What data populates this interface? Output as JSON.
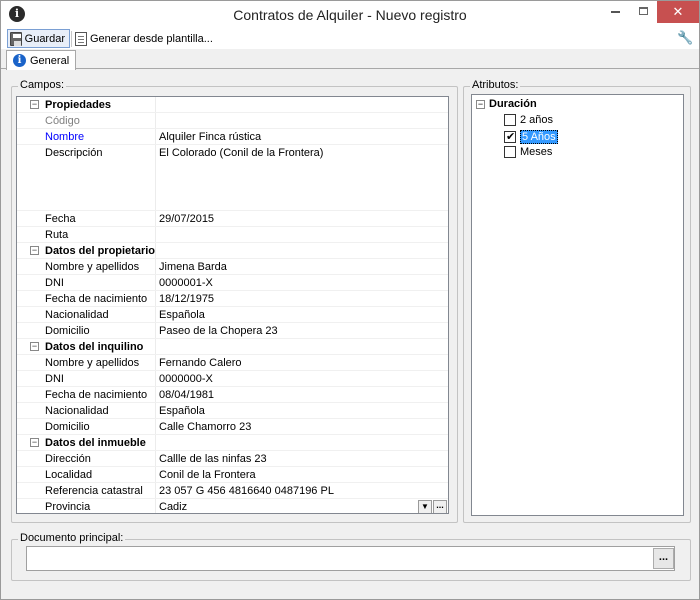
{
  "window": {
    "title": "Contratos de Alquiler - Nuevo registro",
    "close_glyph": "✕"
  },
  "toolbar": {
    "save_label": "Guardar",
    "generate_label": "Generar desde plantilla..."
  },
  "tabs": [
    {
      "label": "General",
      "icon": "info-icon",
      "active": true
    }
  ],
  "campos": {
    "legend": "Campos:",
    "rows": [
      {
        "type": "category",
        "label": "Propiedades"
      },
      {
        "type": "field",
        "label": "Código",
        "value": "",
        "style": "muted"
      },
      {
        "type": "field",
        "label": "Nombre",
        "value": "Alquiler Finca  rústica",
        "style": "required"
      },
      {
        "type": "field",
        "label": "Descripción",
        "value": "El Colorado (Conil de la Frontera)",
        "multiline": true
      },
      {
        "type": "field",
        "label": "Fecha",
        "value": "29/07/2015"
      },
      {
        "type": "field",
        "label": "Ruta",
        "value": ""
      },
      {
        "type": "category",
        "label": "Datos del propietario"
      },
      {
        "type": "field",
        "label": "Nombre y apellidos",
        "value": "Jimena Barda"
      },
      {
        "type": "field",
        "label": "DNI",
        "value": "0000001-X"
      },
      {
        "type": "field",
        "label": "Fecha de nacimiento",
        "value": "18/12/1975"
      },
      {
        "type": "field",
        "label": "Nacionalidad",
        "value": "Española"
      },
      {
        "type": "field",
        "label": "Domicilio",
        "value": "Paseo de la Chopera 23"
      },
      {
        "type": "category",
        "label": "Datos del inquilino"
      },
      {
        "type": "field",
        "label": "Nombre y apellidos",
        "value": "Fernando Calero"
      },
      {
        "type": "field",
        "label": "DNI",
        "value": "0000000-X"
      },
      {
        "type": "field",
        "label": "Fecha de nacimiento",
        "value": "08/04/1981"
      },
      {
        "type": "field",
        "label": "Nacionalidad",
        "value": "Española"
      },
      {
        "type": "field",
        "label": "Domicilio",
        "value": "Calle Chamorro 23"
      },
      {
        "type": "category",
        "label": "Datos del inmueble"
      },
      {
        "type": "field",
        "label": "Dirección",
        "value": "Callle de las ninfas 23"
      },
      {
        "type": "field",
        "label": "Localidad",
        "value": "Conil de la Frontera"
      },
      {
        "type": "field",
        "label": "Referencia catastral",
        "value": "23 057 G 456 4816640 0487196 PL"
      },
      {
        "type": "field",
        "label": "Provincia",
        "value": "Cadiz",
        "combo": true
      }
    ],
    "expander_glyph": "−",
    "combo_down_glyph": "▼",
    "combo_more_glyph": "..."
  },
  "atributos": {
    "legend": "Atributos:",
    "root": "Duración",
    "items": [
      {
        "label": "2 años",
        "checked": false
      },
      {
        "label": "5 Años",
        "checked": true,
        "selected": true
      },
      {
        "label": "Meses",
        "checked": false
      }
    ]
  },
  "documento": {
    "legend": "Documento principal:",
    "value": "",
    "browse_label": "..."
  }
}
